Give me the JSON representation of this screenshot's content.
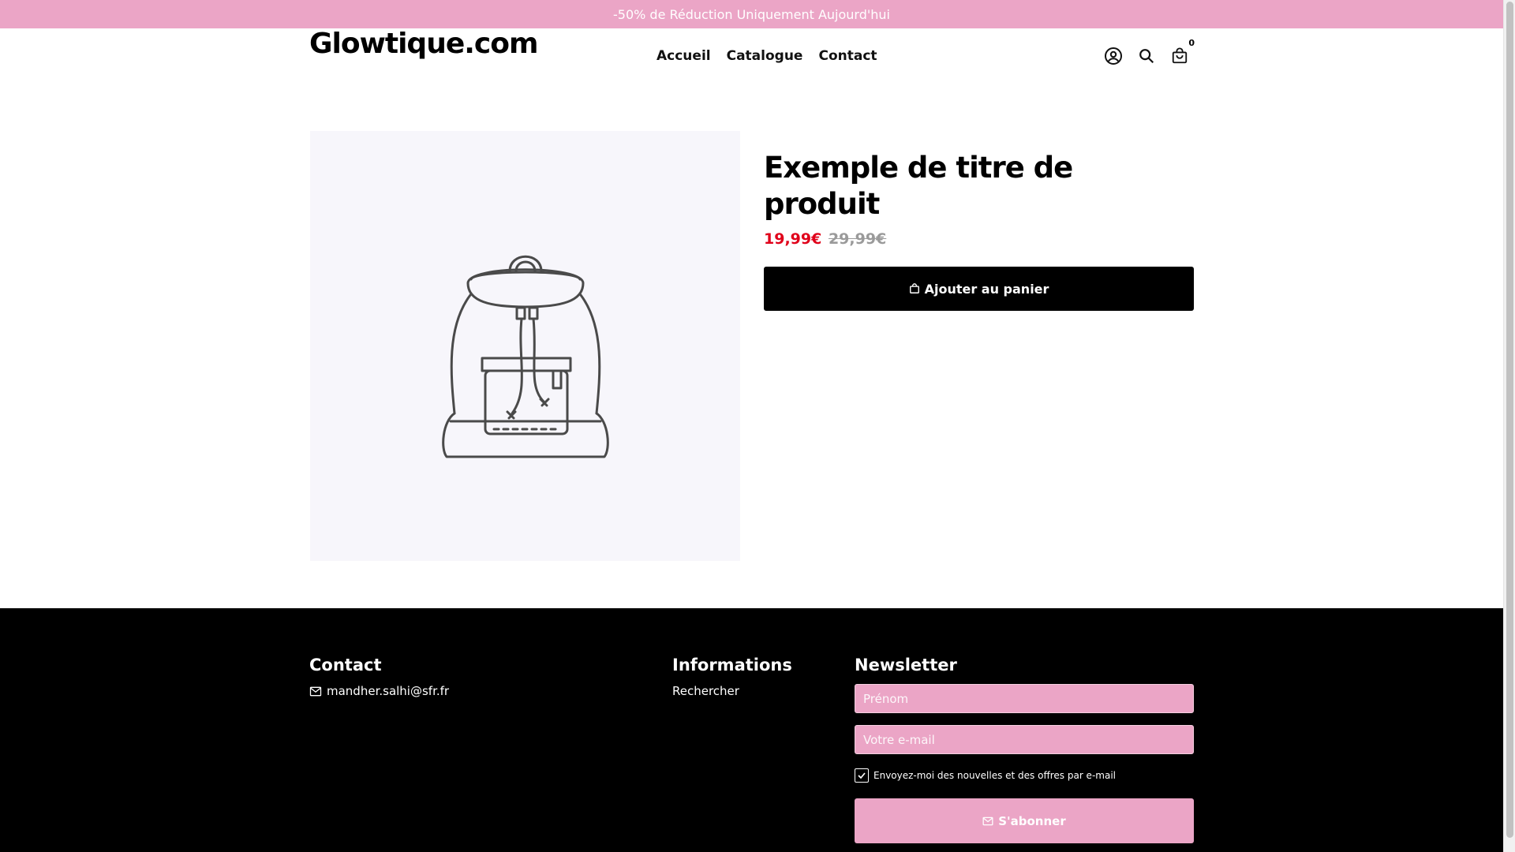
{
  "announcement": "-50% de Réduction Uniquement Aujourd'hui",
  "header": {
    "logo": "Glowtique.com",
    "nav": [
      {
        "label": "Accueil"
      },
      {
        "label": "Catalogue"
      },
      {
        "label": "Contact"
      }
    ],
    "icons": [
      "account-icon",
      "search-icon",
      "cart-icon"
    ],
    "cart_count": "0"
  },
  "product": {
    "title": "Exemple de titre de produit",
    "price_sale": "19,99€",
    "price_old": "29,99€",
    "add_to_cart_label": "Ajouter au panier",
    "image_icon": "backpack-placeholder-icon"
  },
  "footer": {
    "contact": {
      "heading": "Contact",
      "email": "mandher.salhi@sfr.fr"
    },
    "informations": {
      "heading": "Informations",
      "links": [
        {
          "label": "Rechercher"
        }
      ]
    },
    "newsletter": {
      "heading": "Newsletter",
      "first_name_placeholder": "Prénom",
      "email_placeholder": "Votre e-mail",
      "consent_label": "Envoyez-moi des nouvelles et des offres par e-mail",
      "consent_checked": true,
      "subscribe_label": "S'abonner"
    }
  },
  "colors": {
    "accent_pink": "#eba5c6",
    "sale_red": "#e0001a",
    "footer_bg": "#000000"
  }
}
